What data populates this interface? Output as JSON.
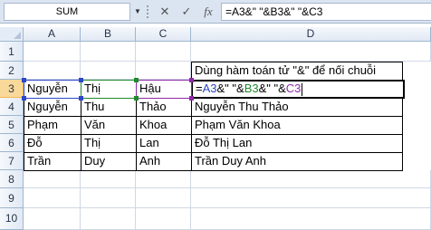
{
  "formula_bar": {
    "name_box": "SUM",
    "cancel_icon": "✕",
    "enter_icon": "✓",
    "fx_label": "fx",
    "formula": "=A3&\" \"&B3&\" \"&C3"
  },
  "columns": [
    "A",
    "B",
    "C",
    "D"
  ],
  "rows": [
    "1",
    "2",
    "3",
    "4",
    "5",
    "6",
    "7",
    "8",
    "9",
    "10"
  ],
  "cells": {
    "D2": "Dùng hàm toán tử \"&\" để nối chuỗi",
    "A3": "Nguyễn",
    "B3": "Thị",
    "C3": "Hậu",
    "D3_parts": [
      "=",
      "A3",
      "&\" \"&",
      "B3",
      "&\" \"&",
      "C3"
    ],
    "A4": "Nguyễn",
    "B4": "Thu",
    "C4": "Thảo",
    "D4": "Nguyễn Thu Thảo",
    "A5": "Phạm",
    "B5": "Văn",
    "C5": "Khoa",
    "D5": "Phạm Văn Khoa",
    "A6": "Đỗ",
    "B6": "Thị",
    "C6": "Lan",
    "D6": "Đỗ Thị Lan",
    "A7": "Trần",
    "B7": "Duy",
    "C7": "Anh",
    "D7": "Trần  Duy Anh"
  },
  "colors": {
    "ref_a": "#2d47c6",
    "ref_b": "#1f8a2d",
    "ref_c": "#8e2aa8",
    "active_header": "#f9d99a"
  }
}
